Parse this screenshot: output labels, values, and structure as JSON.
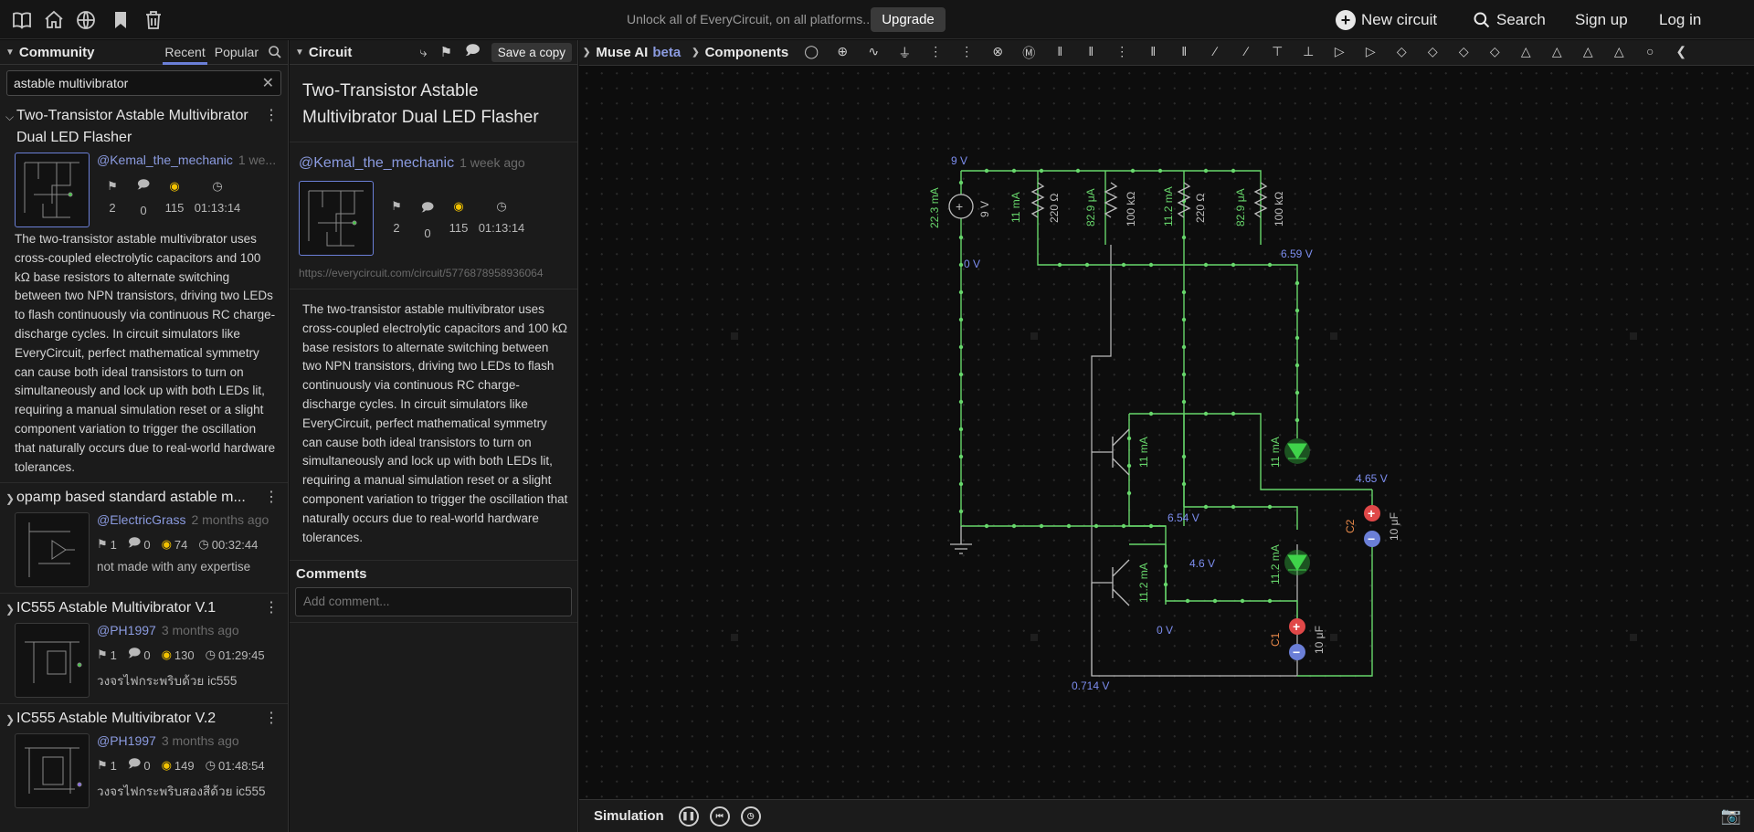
{
  "topbar": {
    "unlock_text": "Unlock all of EveryCircuit, on all platforms...",
    "upgrade_label": "Upgrade",
    "new_circuit_label": "New circuit",
    "search_label": "Search",
    "signup_label": "Sign up",
    "login_label": "Log in",
    "icons": [
      "book-icon",
      "home-icon",
      "globe-icon",
      "bookmark-icon",
      "trash-icon"
    ]
  },
  "community": {
    "title": "Community",
    "tab_recent": "Recent",
    "tab_popular": "Popular",
    "search_value": "astable multivibrator",
    "items": [
      {
        "title": "Two-Transistor Astable Multivibrator Dual LED Flasher",
        "author": "@Kemal_the_mechanic",
        "ago": "1 we...",
        "bookmarks": "2",
        "comments": "0",
        "views": "115",
        "time": "01:13:14",
        "desc": "The two-transistor astable multivibrator uses cross-coupled electrolytic capacitors and 100 kΩ base resistors to alternate switching between two NPN transistors, driving two LEDs to flash continuously via continuous RC charge-discharge cycles. In circuit simulators like EveryCircuit, perfect mathematical symmetry can cause both ideal transistors to turn on simultaneously and lock up with both LEDs lit, requiring a manual simulation reset or a slight component variation to trigger the oscillation that naturally occurs due to real-world hardware tolerances."
      },
      {
        "title": "opamp based standard astable m...",
        "author": "@ElectricGrass",
        "ago": "2 months ago",
        "bookmarks": "1",
        "comments": "0",
        "views": "74",
        "time": "00:32:44",
        "desc": "not made with any expertise"
      },
      {
        "title": "IC555 Astable Multivibrator V.1",
        "author": "@PH1997",
        "ago": "3 months ago",
        "bookmarks": "1",
        "comments": "0",
        "views": "130",
        "time": "01:29:45",
        "desc": "วงจรไฟกระพริบด้วย ic555"
      },
      {
        "title": "IC555 Astable Multivibrator V.2",
        "author": "@PH1997",
        "ago": "3 months ago",
        "bookmarks": "1",
        "comments": "0",
        "views": "149",
        "time": "01:48:54",
        "desc": "วงจรไฟกระพริบสองสีด้วย ic555"
      }
    ]
  },
  "circuit": {
    "header": "Circuit",
    "save_copy_label": "Save a copy",
    "title": "Two-Transistor Astable Multivibrator Dual LED Flasher",
    "author": "@Kemal_the_mechanic",
    "ago": "1 week ago",
    "bookmarks": "2",
    "comments": "0",
    "views": "115",
    "time": "01:13:14",
    "url": "https://everycircuit.com/circuit/5776878958936064",
    "desc": "The two-transistor astable multivibrator uses cross-coupled electrolytic capacitors and 100 kΩ base resistors to alternate switching between two NPN transistors, driving two LEDs to flash continuously via continuous RC charge-discharge cycles. In circuit simulators like EveryCircuit, perfect mathematical symmetry can cause both ideal transistors to turn on simultaneously and lock up with both LEDs lit, requiring a manual simulation reset or a slight component variation to trigger the oscillation that naturally occurs due to real-world hardware tolerances.",
    "comments_header": "Comments",
    "comment_placeholder": "Add comment..."
  },
  "toolbar": {
    "muse": "Muse AI",
    "beta": "beta",
    "components": "Components"
  },
  "bottom": {
    "simulation": "Simulation"
  },
  "schematic": {
    "labels": {
      "v_src": "9 V",
      "v_src_val": "9 V",
      "i_src": "22.3 mA",
      "node_0v_left": "0 V",
      "r1_i": "11 mA",
      "r1_v": "220 Ω",
      "r2_i": "82.9 μA",
      "r2_v": "100 kΩ",
      "r3_i": "11.2 mA",
      "r3_v": "220 Ω",
      "r4_i": "82.9 μA",
      "r4_v": "100 kΩ",
      "node_659": "6.59 V",
      "q1_i": "11 mA",
      "led1_i": "11 mA",
      "node_465": "4.65 V",
      "c2_name": "C2",
      "c2_val": "10 μF",
      "node_654": "6.54 V",
      "node_46": "4.6 V",
      "q2_i": "11.2 mA",
      "led2_i": "11.2 mA",
      "node_0v_bottom": "0 V",
      "c1_name": "C1",
      "c1_val": "10 μF",
      "node_0714": "0.714 V"
    }
  }
}
